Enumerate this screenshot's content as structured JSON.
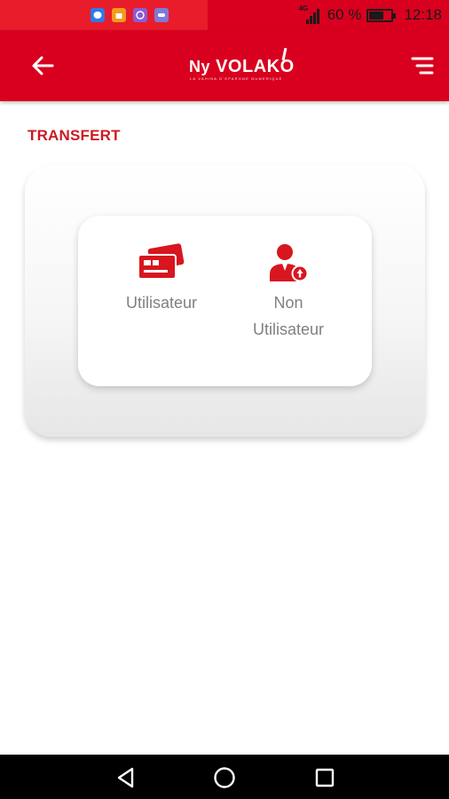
{
  "status_bar": {
    "battery_text": "60 %",
    "time": "12:18",
    "network_label": "4G",
    "battery_level": 0.6,
    "notification_icons": [
      "messenger-icon",
      "shop-icon",
      "viber-icon",
      "game-icon"
    ]
  },
  "app_bar": {
    "logo_prefix": "Ny",
    "logo_main": "VOLAKO",
    "logo_tagline": "LA VAHINA D'EPARGNE NUMERIQUE",
    "back_icon": "arrow-left-icon",
    "menu_icon": "menu-icon"
  },
  "page": {
    "title": "TRANSFERT"
  },
  "options": {
    "utilisateur": {
      "label": "Utilisateur",
      "icon": "cards-icon"
    },
    "non_utilisateur": {
      "label_line1": "Non",
      "label_line2": "Utilisateur",
      "icon": "user-add-icon"
    }
  },
  "colors": {
    "brand_red": "#d8001e",
    "status_left": "#e81c2b",
    "title_red": "#cc1a22",
    "icon_red": "#d7161f",
    "label_gray": "#808080"
  },
  "nav_bar": {
    "back_icon": "nav-back-icon",
    "home_icon": "nav-home-icon",
    "recents_icon": "nav-recents-icon"
  }
}
